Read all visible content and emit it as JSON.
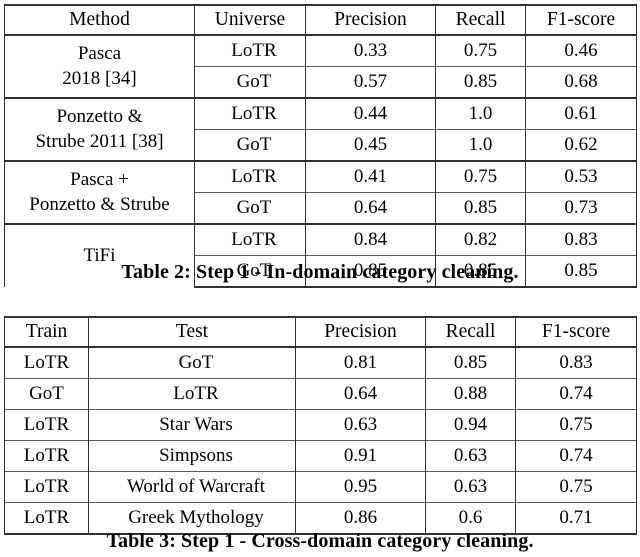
{
  "document": {
    "type": "paper-tables-figure",
    "background_color": "#ffffff",
    "text_color": "#000000",
    "rule_color": "#303030"
  },
  "table2": {
    "id": "table-2",
    "caption": "Table 2: Step 1 - In-domain category cleaning.",
    "columns": [
      "Method",
      "Universe",
      "Precision",
      "Recall",
      "F1-score"
    ],
    "groups": [
      {
        "method_lines": [
          "Pasca",
          "2018 [34]"
        ],
        "rows": [
          {
            "universe": "LoTR",
            "precision": "0.33",
            "recall": "0.75",
            "f1": "0.46",
            "bold": {
              "precision": false,
              "recall": false,
              "f1": false
            }
          },
          {
            "universe": "GoT",
            "precision": "0.57",
            "recall": "0.85",
            "f1": "0.68",
            "bold": {
              "precision": false,
              "recall": false,
              "f1": false
            }
          }
        ]
      },
      {
        "method_lines": [
          "Ponzetto &",
          "Strube 2011 [38]"
        ],
        "rows": [
          {
            "universe": "LoTR",
            "precision": "0.44",
            "recall": "1.0",
            "f1": "0.61",
            "bold": {
              "precision": false,
              "recall": true,
              "f1": false
            }
          },
          {
            "universe": "GoT",
            "precision": "0.45",
            "recall": "1.0",
            "f1": "0.62",
            "bold": {
              "precision": false,
              "recall": true,
              "f1": false
            }
          }
        ]
      },
      {
        "method_lines": [
          "Pasca +",
          "Ponzetto & Strube"
        ],
        "rows": [
          {
            "universe": "LoTR",
            "precision": "0.41",
            "recall": "0.75",
            "f1": "0.53",
            "bold": {
              "precision": false,
              "recall": false,
              "f1": false
            }
          },
          {
            "universe": "GoT",
            "precision": "0.64",
            "recall": "0.85",
            "f1": "0.73",
            "bold": {
              "precision": false,
              "recall": false,
              "f1": false
            }
          }
        ]
      },
      {
        "method_lines": [
          "TiFi"
        ],
        "rows": [
          {
            "universe": "LoTR",
            "precision": "0.84",
            "recall": "0.82",
            "f1": "0.83",
            "bold": {
              "precision": true,
              "recall": false,
              "f1": true
            }
          },
          {
            "universe": "GoT",
            "precision": "0.85",
            "recall": "0.85",
            "f1": "0.85",
            "bold": {
              "precision": true,
              "recall": false,
              "f1": true
            }
          }
        ]
      }
    ]
  },
  "table3": {
    "id": "table-3",
    "caption": "Table 3: Step 1 - Cross-domain category cleaning.",
    "columns": [
      "Train",
      "Test",
      "Precision",
      "Recall",
      "F1-score"
    ],
    "rows": [
      {
        "train": "LoTR",
        "test": "GoT",
        "precision": "0.81",
        "recall": "0.85",
        "f1": "0.83"
      },
      {
        "train": "GoT",
        "test": "LoTR",
        "precision": "0.64",
        "recall": "0.88",
        "f1": "0.74"
      },
      {
        "train": "LoTR",
        "test": "Star Wars",
        "precision": "0.63",
        "recall": "0.94",
        "f1": "0.75"
      },
      {
        "train": "LoTR",
        "test": "Simpsons",
        "precision": "0.91",
        "recall": "0.63",
        "f1": "0.74"
      },
      {
        "train": "LoTR",
        "test": "World of Warcraft",
        "precision": "0.95",
        "recall": "0.63",
        "f1": "0.75"
      },
      {
        "train": "LoTR",
        "test": "Greek Mythology",
        "precision": "0.86",
        "recall": "0.6",
        "f1": "0.71"
      }
    ]
  }
}
